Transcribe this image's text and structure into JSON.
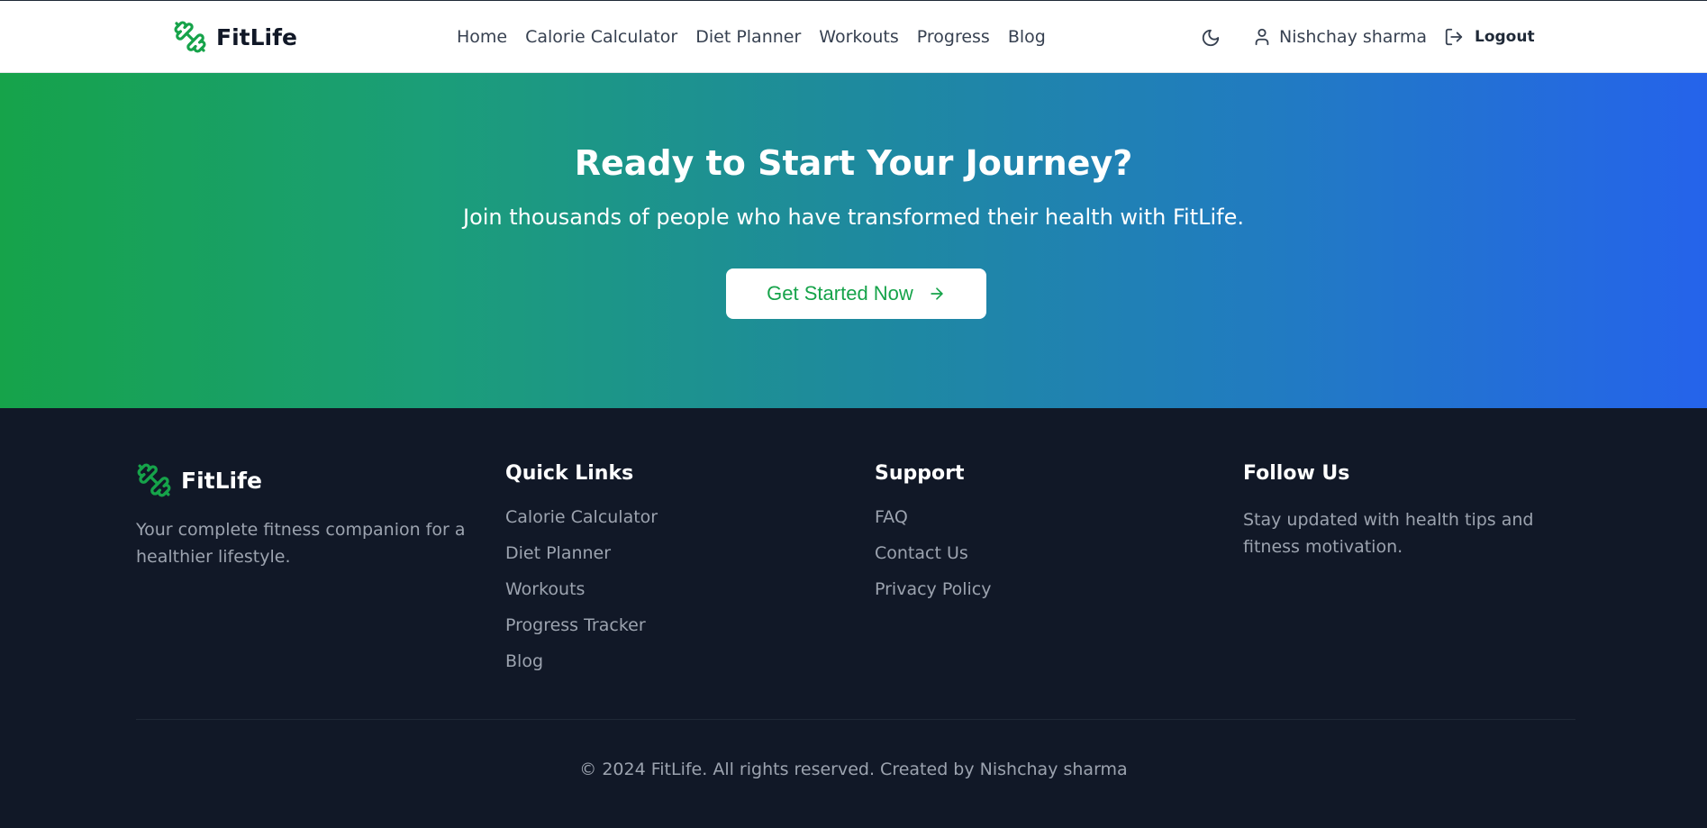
{
  "header": {
    "brand": "FitLife",
    "nav": [
      "Home",
      "Calorie Calculator",
      "Diet Planner",
      "Workouts",
      "Progress",
      "Blog"
    ],
    "user_name": "Nishchay sharma",
    "logout_label": "Logout",
    "icons": {
      "logo": "dumbbell-icon",
      "theme": "moon-icon",
      "user": "user-icon",
      "logout": "logout-icon"
    }
  },
  "hero": {
    "title": "Ready to Start Your Journey?",
    "subtitle": "Join thousands of people who have transformed their health with FitLife.",
    "cta_label": "Get Started Now",
    "cta_icon": "arrow-right-icon",
    "gradient_start": "#16a34a",
    "gradient_end": "#2563eb"
  },
  "footer": {
    "brand": "FitLife",
    "tagline": "Your complete fitness companion for a healthier lifestyle.",
    "quick_links": {
      "title": "Quick Links",
      "items": [
        "Calorie Calculator",
        "Diet Planner",
        "Workouts",
        "Progress Tracker",
        "Blog"
      ]
    },
    "support": {
      "title": "Support",
      "items": [
        "FAQ",
        "Contact Us",
        "Privacy Policy"
      ]
    },
    "follow": {
      "title": "Follow Us",
      "text": "Stay updated with health tips and fitness motivation."
    },
    "copyright": "© 2024 FitLife. All rights reserved. Created by Nishchay sharma"
  },
  "colors": {
    "accent": "#16a34a",
    "footer_bg": "#111827",
    "muted_text": "#9ca3af"
  }
}
